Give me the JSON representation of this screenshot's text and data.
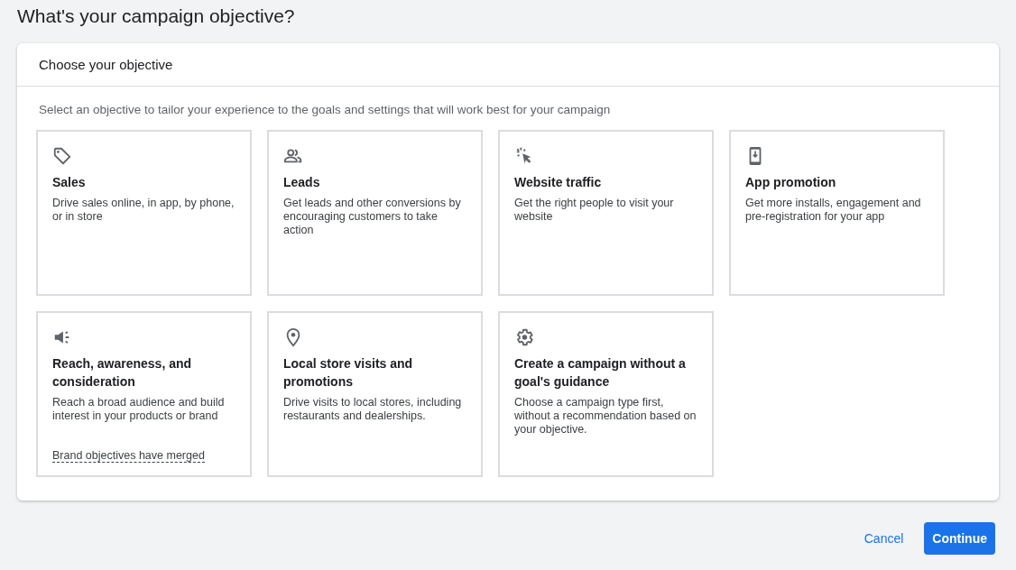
{
  "page_title": "What's your campaign objective?",
  "panel": {
    "heading": "Choose your objective",
    "description": "Select an objective to tailor your experience to the goals and settings that will work best for your campaign"
  },
  "objectives": [
    {
      "kind": "tag",
      "title": "Sales",
      "description": "Drive sales online, in app, by phone, or in store",
      "selected": false
    },
    {
      "kind": "people",
      "title": "Leads",
      "description": "Get leads and other conversions by encouraging customers to take action",
      "selected": false
    },
    {
      "kind": "cursor",
      "title": "Website traffic",
      "description": "Get the right people to visit your website",
      "selected": false
    },
    {
      "kind": "phone",
      "title": "App promotion",
      "description": "Get more installs, engagement and pre-registration for your app",
      "selected": false
    },
    {
      "kind": "megaphone",
      "title": "Reach, awareness, and consideration",
      "description": "Reach a broad audience and build interest in your products or brand",
      "note": "Brand objectives have merged",
      "selected": false
    },
    {
      "kind": "pin",
      "title": "Local store visits and promotions",
      "description": "Drive visits to local stores, including restaurants and dealerships.",
      "selected": false
    },
    {
      "kind": "gear",
      "title": "Create a campaign without a goal's guidance",
      "description": "Choose a campaign type first, without a recommendation based on your objective.",
      "selected": false
    }
  ],
  "buttons": [
    {
      "kind": "text",
      "label": "Cancel"
    },
    {
      "kind": "primary",
      "label": "Continue"
    }
  ]
}
